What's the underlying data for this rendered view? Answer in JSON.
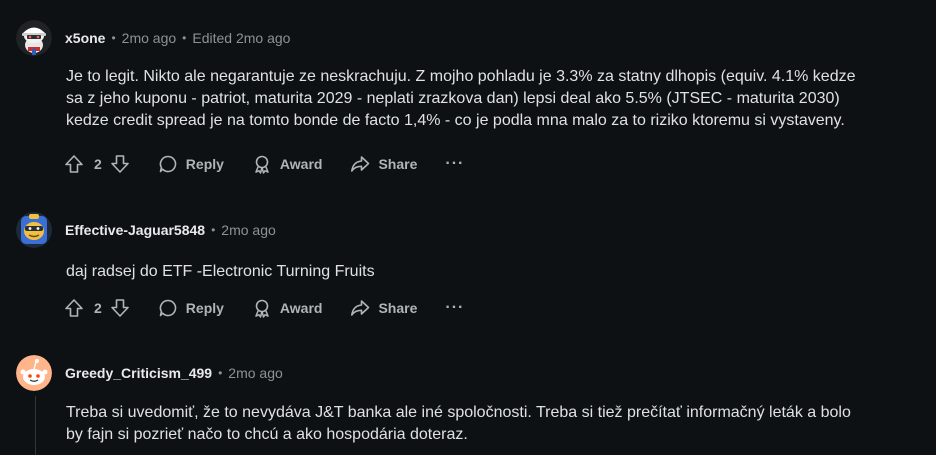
{
  "comments": [
    {
      "author": "x5one",
      "separator": "•",
      "time": "2mo ago",
      "edited": "Edited 2mo ago",
      "avatar_icon": "snoo-avatar-white-cap",
      "body_lines": [
        "Je to legit. Nikto ale negarantuje ze neskrachuju. Z mojho pohladu je 3.3% za statny dlhopis (equiv. 4.1% kedze",
        "sa z jeho kuponu - patriot, maturita 2029 - neplati zrazkova dan) lepsi deal ako 5.5% (JTSEC - maturita 2030)",
        "kedze credit spread je na tomto bonde de facto 1,4% - co je podla mna malo za to riziko ktoremu si vystaveny."
      ],
      "votes": "2",
      "reply_label": "Reply",
      "award_label": "Award",
      "share_label": "Share",
      "more_label": "···"
    },
    {
      "author": "Effective-Jaguar5848",
      "separator": "•",
      "time": "2mo ago",
      "avatar_icon": "snoo-avatar-blue-helmet",
      "body_lines": [
        "daj radsej do ETF -Electronic Turning Fruits"
      ],
      "votes": "2",
      "reply_label": "Reply",
      "award_label": "Award",
      "share_label": "Share",
      "more_label": "···"
    },
    {
      "author": "Greedy_Criticism_499",
      "separator": "•",
      "time": "2mo ago",
      "avatar_icon": "snoo-avatar-default-orange",
      "body_lines": [
        "Treba si uvedomiť, že to nevydáva J&T banka ale iné spoločnosti. Treba si tiež prečítať informačný leták a bolo",
        "by fajn si pozrieť načo to chcú a ako hospodária doteraz."
      ]
    }
  ],
  "colors": {
    "background": "#0e1113",
    "text": "#dfe1e2",
    "meta": "#8b9296",
    "action": "#aeb4b8",
    "thread_line": "#33373a"
  }
}
